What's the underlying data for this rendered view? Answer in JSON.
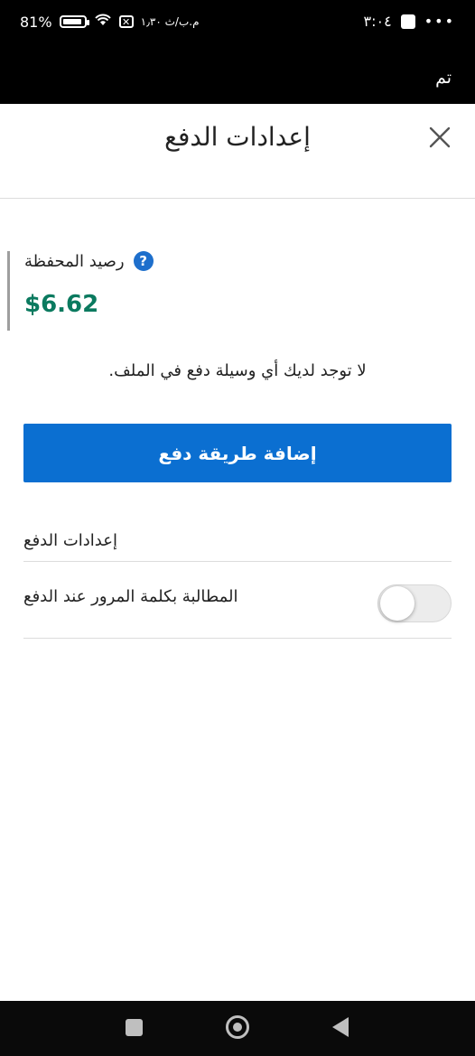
{
  "status_bar": {
    "battery_text": "81%",
    "time": "٣:٠٤",
    "notif_text": "م.ب/ث ١٫٣٠",
    "more_dots": "•••"
  },
  "top_bar": {
    "done_label": "تم"
  },
  "header": {
    "title": "إعدادات الدفع"
  },
  "wallet": {
    "label": "رصيد المحفظة",
    "help_symbol": "?",
    "amount": "$6.62"
  },
  "no_payment_text": ".لا توجد لديك أي وسيلة دفع في الملف",
  "add_button_label": "إضافة طريقة دفع",
  "settings": {
    "section_label": "إعدادات الدفع",
    "require_password_label": "المطالبة بكلمة المرور عند الدفع",
    "require_password_enabled": false
  },
  "colors": {
    "accent": "#0b6fd1",
    "amount": "#0b7a5f",
    "help": "#1e6fcc"
  },
  "icons": {
    "close": "close-icon",
    "help": "help-icon",
    "nav_recents": "square-icon",
    "nav_home": "home-circle-icon",
    "nav_back": "back-triangle-icon"
  }
}
